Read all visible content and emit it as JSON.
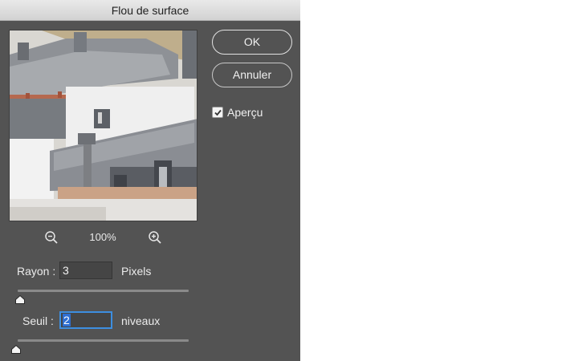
{
  "dialog": {
    "title": "Flou de surface",
    "ok_label": "OK",
    "cancel_label": "Annuler",
    "preview": {
      "label": "Aperçu",
      "checked": true
    },
    "zoom": {
      "level": "100%",
      "zoom_out_icon": "zoom-out-icon",
      "zoom_in_icon": "zoom-in-icon"
    },
    "radius": {
      "label": "Rayon :",
      "value": "3",
      "unit": "Pixels",
      "slider_fraction": 0.02
    },
    "threshold": {
      "label": "Seuil :",
      "value": "2",
      "unit": "niveaux",
      "slider_fraction": 0.0
    }
  },
  "colors": {
    "panel": "#535353",
    "title_bar": "#dedede",
    "input_bg": "#454545",
    "focus": "#3d8ee0",
    "selection": "#2f6fd1"
  }
}
